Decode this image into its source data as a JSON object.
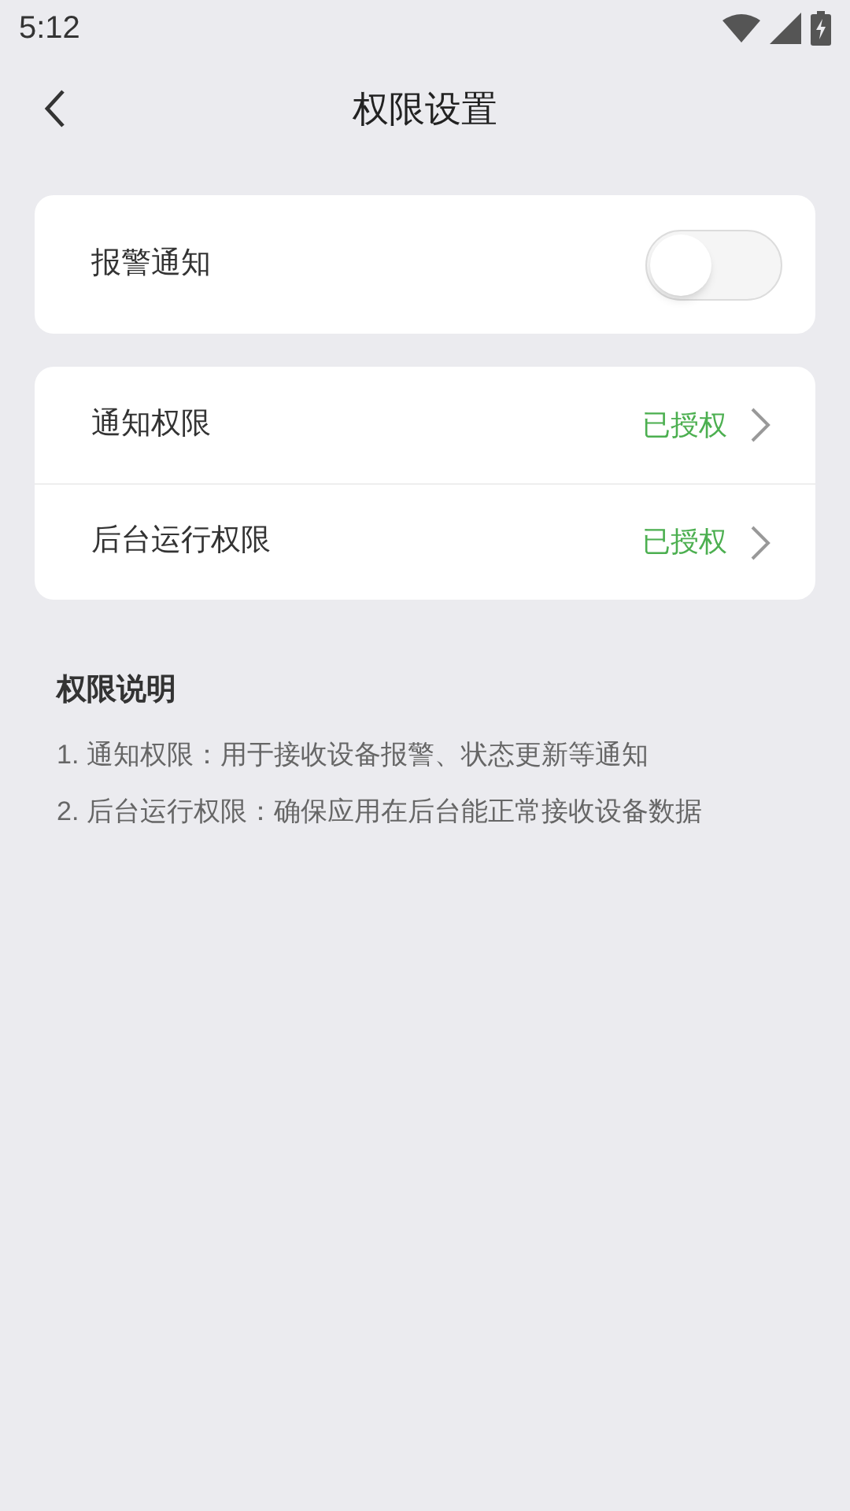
{
  "status_bar": {
    "time": "5:12"
  },
  "header": {
    "title": "权限设置"
  },
  "alarm": {
    "label": "报警通知",
    "on": false
  },
  "permissions": [
    {
      "label": "通知权限",
      "status": "已授权"
    },
    {
      "label": "后台运行权限",
      "status": "已授权"
    }
  ],
  "explanation": {
    "title": "权限说明",
    "lines": [
      "1. 通知权限：用于接收设备报警、状态更新等通知",
      "2. 后台运行权限：确保应用在后台能正常接收设备数据"
    ]
  }
}
